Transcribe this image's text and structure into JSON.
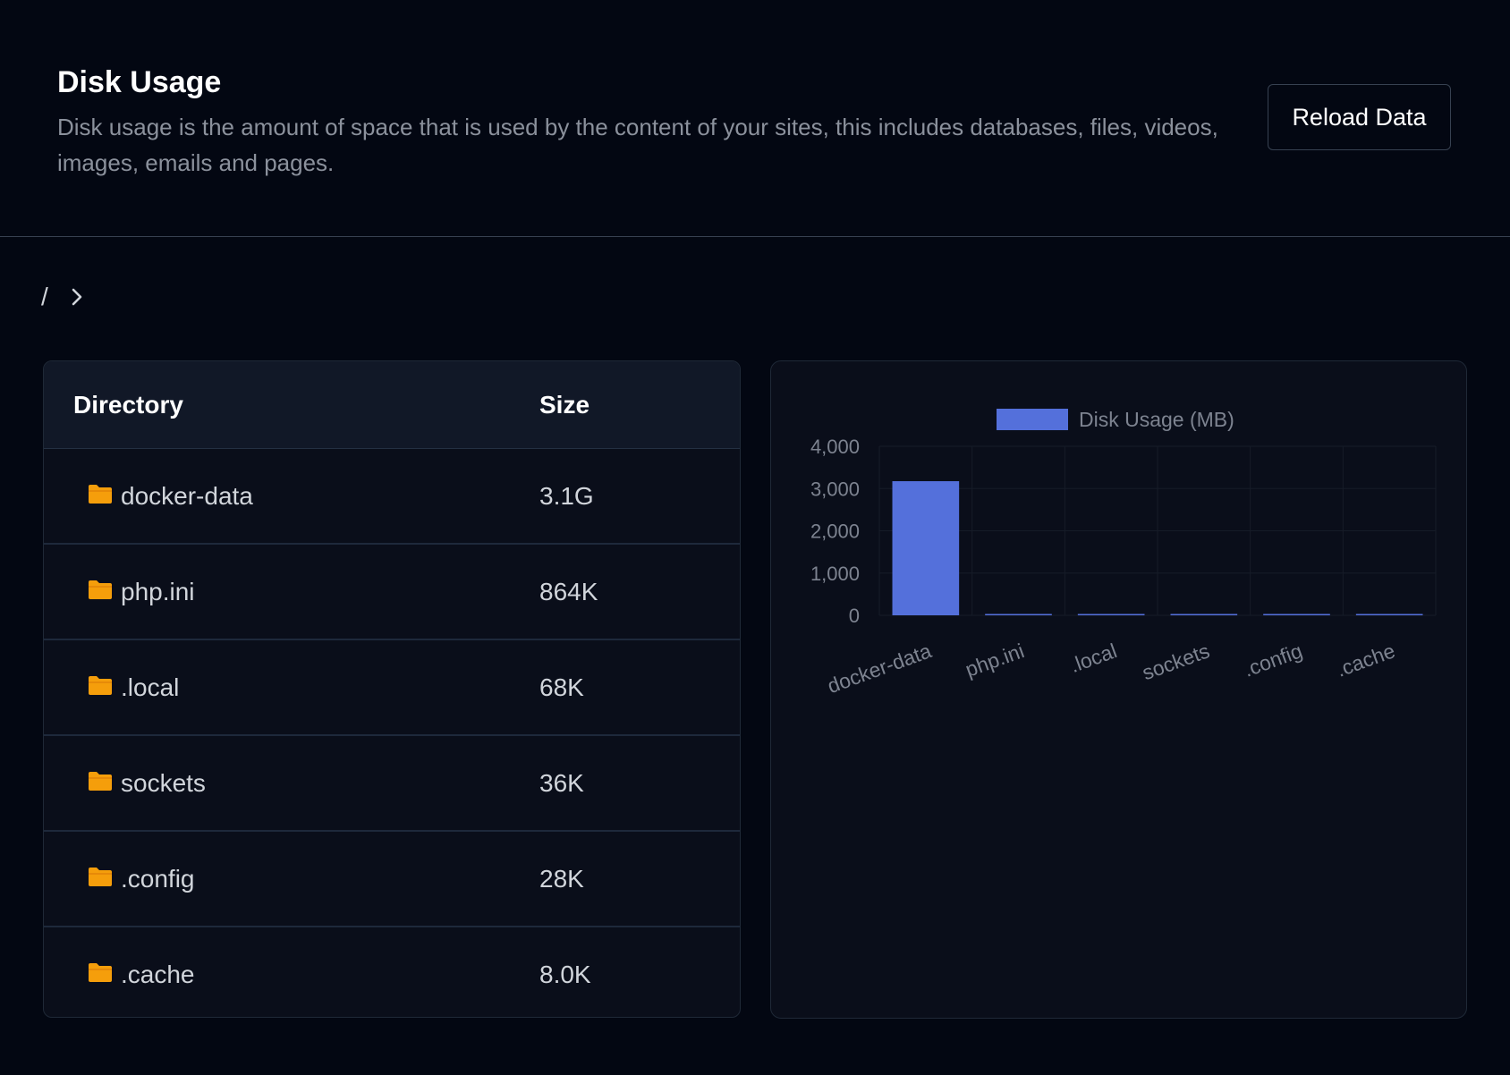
{
  "header": {
    "title": "Disk Usage",
    "description": "Disk usage is the amount of space that is used by the content of your sites, this includes databases, files, videos, images, emails and pages.",
    "reload_label": "Reload Data"
  },
  "breadcrumb": {
    "root": "/",
    "separator_icon": "chevron-right-icon"
  },
  "table": {
    "headers": {
      "directory": "Directory",
      "size": "Size"
    },
    "folder_icon": "folder-icon",
    "folder_color": "#f59e0b",
    "rows": [
      {
        "name": "docker-data",
        "size": "3.1G"
      },
      {
        "name": "php.ini",
        "size": "864K"
      },
      {
        "name": ".local",
        "size": "68K"
      },
      {
        "name": "sockets",
        "size": "36K"
      },
      {
        "name": ".config",
        "size": "28K"
      },
      {
        "name": ".cache",
        "size": "8.0K"
      }
    ]
  },
  "chart_data": {
    "type": "bar",
    "categories": [
      "docker-data",
      "php.ini",
      ".local",
      "sockets",
      ".config",
      ".cache"
    ],
    "series": [
      {
        "name": "Disk Usage (MB)",
        "values": [
          3174,
          0.84,
          0.07,
          0.04,
          0.03,
          0.01
        ],
        "color": "#5470db"
      }
    ],
    "ylim": [
      0,
      4000
    ],
    "yticks": [
      "0",
      "1,000",
      "2,000",
      "3,000",
      "4,000"
    ],
    "ytick_values": [
      0,
      1000,
      2000,
      3000,
      4000
    ],
    "legend_position": "top",
    "grid": true
  }
}
